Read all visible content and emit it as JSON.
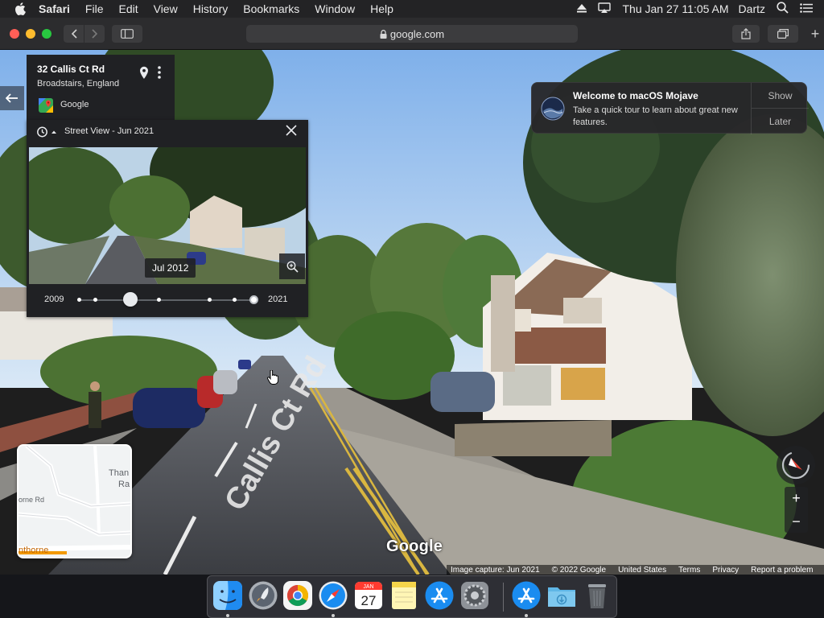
{
  "menubar": {
    "app_name": "Safari",
    "items": [
      "File",
      "Edit",
      "View",
      "History",
      "Bookmarks",
      "Window",
      "Help"
    ],
    "clock": "Thu Jan 27  11:05 AM",
    "user": "Dartz"
  },
  "browser": {
    "address": "google.com"
  },
  "place_card": {
    "address": "32 Callis Ct Rd",
    "locality": "Broadstairs, England",
    "source": "Google"
  },
  "timeline": {
    "header": "Street View - Jun 2021",
    "thumbnail_date": "Jul 2012",
    "start_year": "2009",
    "end_year": "2021"
  },
  "notification": {
    "title": "Welcome to macOS Mojave",
    "body": "Take a quick tour to learn about great new features.",
    "show_label": "Show",
    "later_label": "Later"
  },
  "minimap": {
    "labels": [
      "Than",
      "Ra",
      "orne Rd",
      "nthorne"
    ]
  },
  "streetview": {
    "road_name": "Callis Ct Rd",
    "watermark": "Google"
  },
  "footer": {
    "capture": "Image capture: Jun 2021",
    "copyright": "© 2022 Google",
    "region": "United States",
    "terms": "Terms",
    "privacy": "Privacy",
    "report": "Report a problem"
  },
  "dock": {
    "calendar_month": "JAN",
    "calendar_day": "27",
    "apps": [
      "finder-icon",
      "launchpad-icon",
      "chrome-icon",
      "safari-icon",
      "calendar-icon",
      "notes-icon",
      "app-store-icon",
      "system-preferences-icon",
      "app-store-downloads-icon",
      "downloads-folder-icon",
      "trash-icon"
    ]
  },
  "colors": {
    "map_panel": "#202124",
    "menubar": "#232325",
    "notification": "#28282a"
  }
}
